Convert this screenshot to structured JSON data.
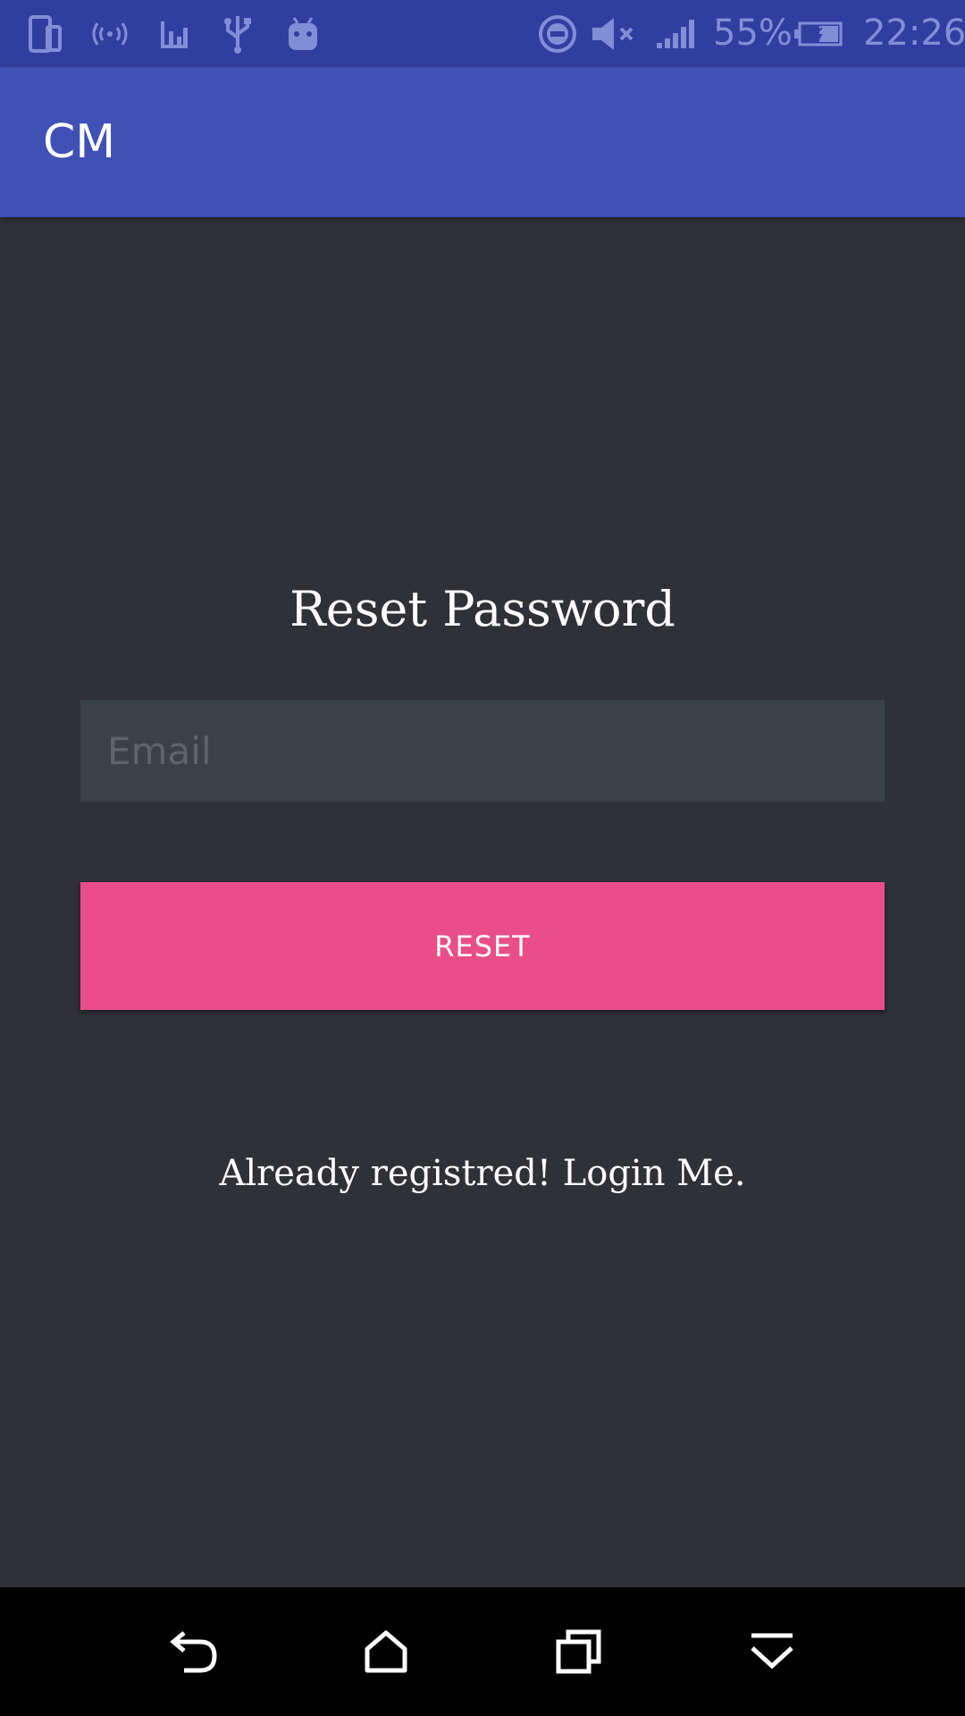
{
  "status_bar": {
    "battery_percent": "55%",
    "time": "22:26",
    "icons": [
      "phone-dual-icon",
      "hotspot-icon",
      "stats-icon",
      "usb-icon",
      "android-icon",
      "do-not-disturb-icon",
      "mute-icon",
      "signal-icon",
      "battery-charging-icon"
    ]
  },
  "app_bar": {
    "title": "CM"
  },
  "form": {
    "heading": "Reset Password",
    "email_placeholder": "Email",
    "email_value": "",
    "reset_label": "RESET",
    "login_link": "Already registred! Login Me."
  },
  "nav_bar": {
    "icons": [
      "back-icon",
      "home-icon",
      "recents-icon",
      "collapse-icon"
    ]
  },
  "colors": {
    "status_bar": "#303f9f",
    "app_bar": "#3f51b5",
    "background": "#2f3136",
    "input_bg": "#3b4149",
    "accent": "#e94e88"
  }
}
